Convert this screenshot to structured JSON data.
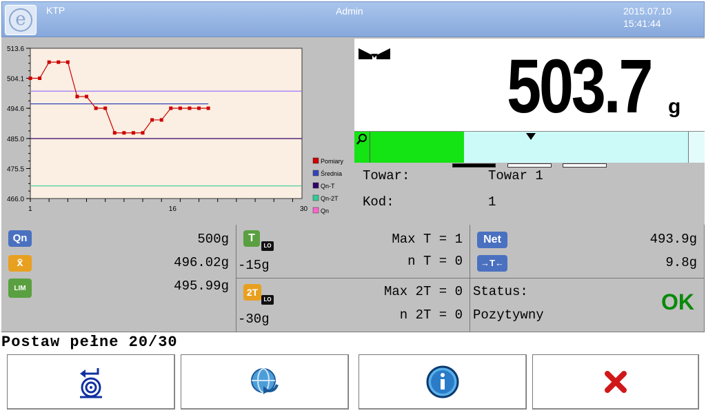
{
  "header": {
    "left_label": "KTP",
    "center_label": "Admin",
    "date": "2015.07.10",
    "time": "15:41:44"
  },
  "chart_data": {
    "type": "line",
    "ylim": [
      466.0,
      513.6
    ],
    "yticks": [
      "513.6",
      "504.1",
      "494.6",
      "485.0",
      "475.5",
      "466.0"
    ],
    "xlim": [
      1,
      30
    ],
    "xticks": [
      "1",
      "16",
      "30"
    ],
    "legend": [
      "Pomiary",
      "Średnia",
      "Qn-T",
      "Qn-2T",
      "Qn"
    ],
    "legend_colors": [
      "#cc0000",
      "#3344bb",
      "#330066",
      "#33cc99",
      "#ff66cc"
    ],
    "series": [
      {
        "name": "Pomiary",
        "color": "#cc0000",
        "x": [
          1,
          2,
          3,
          4,
          5,
          6,
          7,
          8,
          9,
          10,
          11,
          12,
          13,
          14,
          15,
          16,
          17,
          18,
          19,
          20
        ],
        "values": [
          504.1,
          504.1,
          509.2,
          509.2,
          509.2,
          498.3,
          498.3,
          494.6,
          494.6,
          486.8,
          486.8,
          486.8,
          486.8,
          490.9,
          490.9,
          494.6,
          494.6,
          494.6,
          494.6,
          494.6
        ]
      }
    ],
    "hlines": [
      {
        "name": "Średnia",
        "value": 496.0,
        "color": "#3344bb",
        "x_end": 20
      },
      {
        "name": "Qn-T",
        "value": 485.0,
        "color": "#330066",
        "x_end": 30
      },
      {
        "name": "Qn-2T",
        "value": 470.0,
        "color": "#33cc99",
        "x_end": 30
      },
      {
        "name": "Qn",
        "value": 500.0,
        "color": "#9977ff",
        "x_end": 30
      }
    ]
  },
  "display": {
    "weight_value": "503.7",
    "weight_unit": "g",
    "bar_fill_fraction": 0.31,
    "towar_label": "Towar:",
    "towar_value": "Towar 1",
    "kod_label": "Kod:",
    "kod_value": "1"
  },
  "stats": {
    "qn_badge": "Qn",
    "qn_value": "500g",
    "mean_badge": "x̄",
    "mean_value": "496.02g",
    "lim_badge": "LIM",
    "lim_value": "495.99g",
    "t_badge": "T",
    "t_lo": "LO",
    "t_value": "-15g",
    "max_t": "Max T = 1",
    "n_t": "n T = 0",
    "t2_badge": "2T",
    "t2_lo": "LO",
    "t2_value": "-30g",
    "max_2t": "Max 2T = 0",
    "n_2t": "n 2T = 0",
    "net_badge": "Net",
    "net_value": "493.9g",
    "tare_badge": "→T←",
    "tare_value": "9.8g",
    "status_label": "Status:",
    "status_text": "Pozytywny",
    "status_result": "OK"
  },
  "prompt": "Postaw pełne 20/30",
  "buttons": [
    {
      "icon": "tare-zero-icon"
    },
    {
      "icon": "refresh-icon"
    },
    {
      "icon": "info-icon"
    },
    {
      "icon": "cancel-icon"
    }
  ],
  "colors": {
    "header_bg": "#87a8dc",
    "panel_bg": "#c0c0c0",
    "chart_bg": "#fbeee2",
    "bar_green": "#14e314",
    "bar_light": "#ccfaf8",
    "status_ok": "#0a8a0a",
    "badge_blue": "#4a70c0",
    "badge_orange": "#e8a020",
    "badge_green": "#5aa040"
  }
}
